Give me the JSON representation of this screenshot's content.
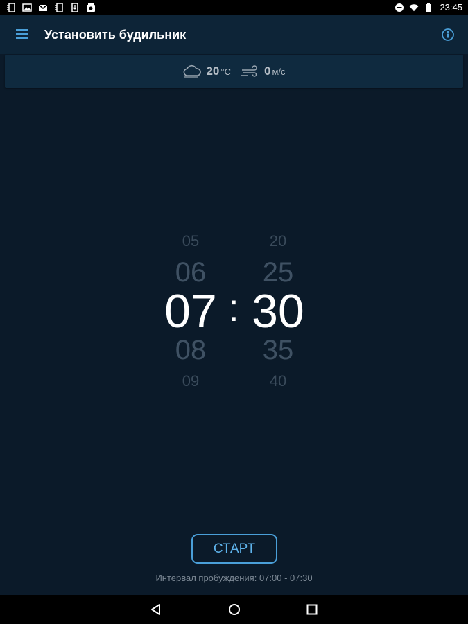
{
  "status_bar": {
    "time": "23:45",
    "left_icons": [
      "sim-icon",
      "image-icon",
      "gmail-icon",
      "sim-icon",
      "download-icon",
      "photo-album-icon"
    ],
    "right_icons": [
      "do-not-disturb-icon",
      "wifi-icon",
      "battery-icon"
    ]
  },
  "app_bar": {
    "title": "Установить будильник",
    "menu_icon": "hamburger-menu-icon",
    "info_icon": "info-icon"
  },
  "weather": {
    "temperature_value": "20",
    "temperature_unit": "°C",
    "wind_value": "0",
    "wind_unit": "м/с",
    "temperature_icon": "cloud-icon",
    "wind_icon": "wind-icon"
  },
  "time_picker": {
    "hours": {
      "far_above": "05",
      "above": "06",
      "selected": "07",
      "below": "08",
      "far_below": "09"
    },
    "separator": ":",
    "minutes": {
      "far_above": "20",
      "above": "25",
      "selected": "30",
      "below": "35",
      "far_below": "40"
    }
  },
  "start_button": {
    "label": "СТАРТ"
  },
  "interval_text": "Интервал пробуждения: 07:00 - 07:30",
  "nav_bar": {
    "buttons": [
      "back-icon",
      "home-icon",
      "recents-icon"
    ]
  },
  "colors": {
    "background": "#0b1a29",
    "app_bar": "#0d2437",
    "accent": "#4a9fd8",
    "muted_text": "#7c8894"
  }
}
